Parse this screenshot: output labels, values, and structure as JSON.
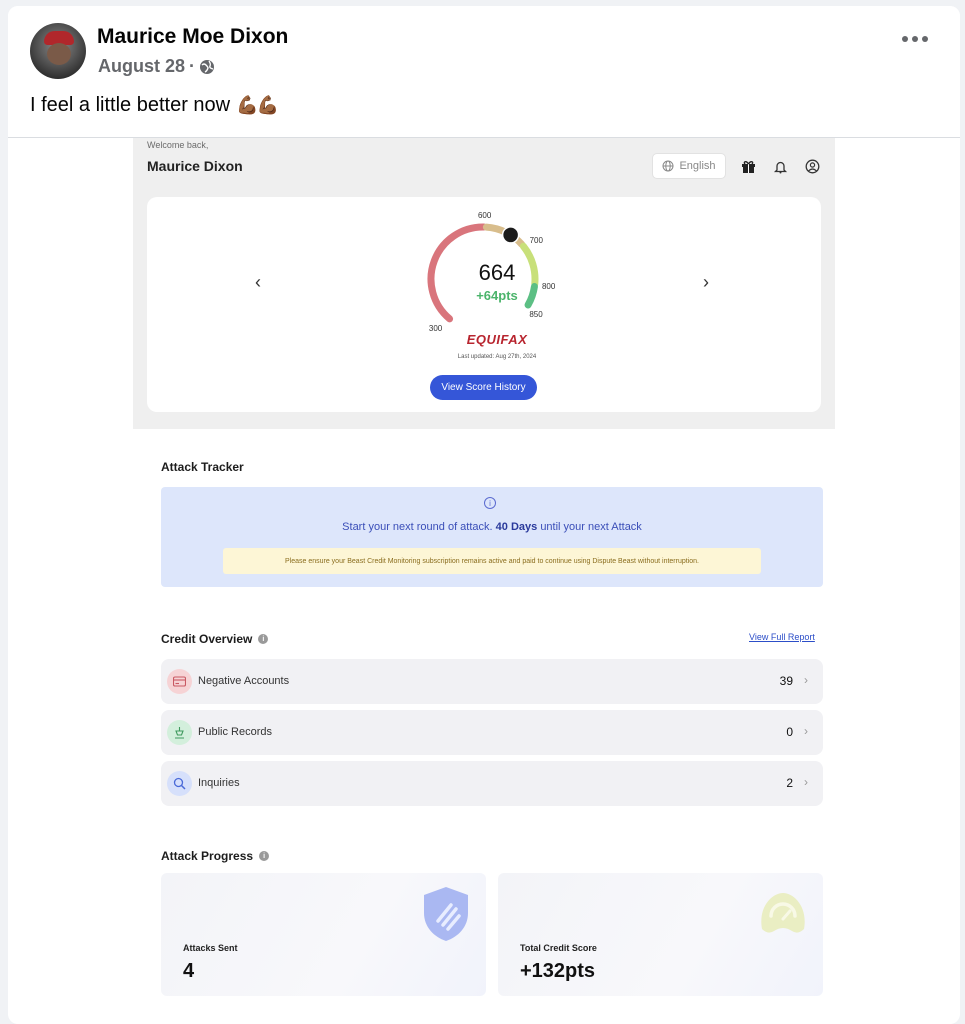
{
  "post": {
    "author": "Maurice Moe Dixon",
    "date": "August 28",
    "separator": "·",
    "text": "I feel a little better now",
    "emoji": "💪🏾💪🏾"
  },
  "app": {
    "welcome": "Welcome back,",
    "user_name": "Maurice Dixon",
    "language": "English",
    "score": {
      "value": "664",
      "delta": "+64pts",
      "bureau": "EQUIFAX",
      "updated": "Last updated: Aug 27th, 2024",
      "ticks": [
        "300",
        "600",
        "700",
        "800",
        "850"
      ],
      "history_button": "View Score History",
      "gauge_min": 300,
      "gauge_max": 850,
      "colors": {
        "poor": "#d9757c",
        "fair": "#d8bd8c",
        "good": "#c8e07a",
        "excellent": "#5cbf84"
      }
    },
    "attack_tracker": {
      "title": "Attack Tracker",
      "message_prefix": "Start your next round of attack.",
      "message_bold": "40 Days",
      "message_suffix": "until your next Attack",
      "note": "Please ensure your Beast Credit Monitoring subscription remains active and paid to continue using Dispute Beast without interruption."
    },
    "credit_overview": {
      "title": "Credit Overview",
      "link": "View Full Report",
      "rows": [
        {
          "label": "Negative Accounts",
          "count": "39",
          "icon": "negative-accounts-icon",
          "color": "#f6d3d5"
        },
        {
          "label": "Public Records",
          "count": "0",
          "icon": "public-records-icon",
          "color": "#d3efdc"
        },
        {
          "label": "Inquiries",
          "count": "2",
          "icon": "inquiries-icon",
          "color": "#d6e0fb"
        }
      ]
    },
    "attack_progress": {
      "title": "Attack Progress",
      "cards": [
        {
          "label": "Attacks Sent",
          "value": "4",
          "icon": "shield-icon"
        },
        {
          "label": "Total Credit Score",
          "value": "+132pts",
          "icon": "speedometer-icon"
        }
      ]
    }
  }
}
